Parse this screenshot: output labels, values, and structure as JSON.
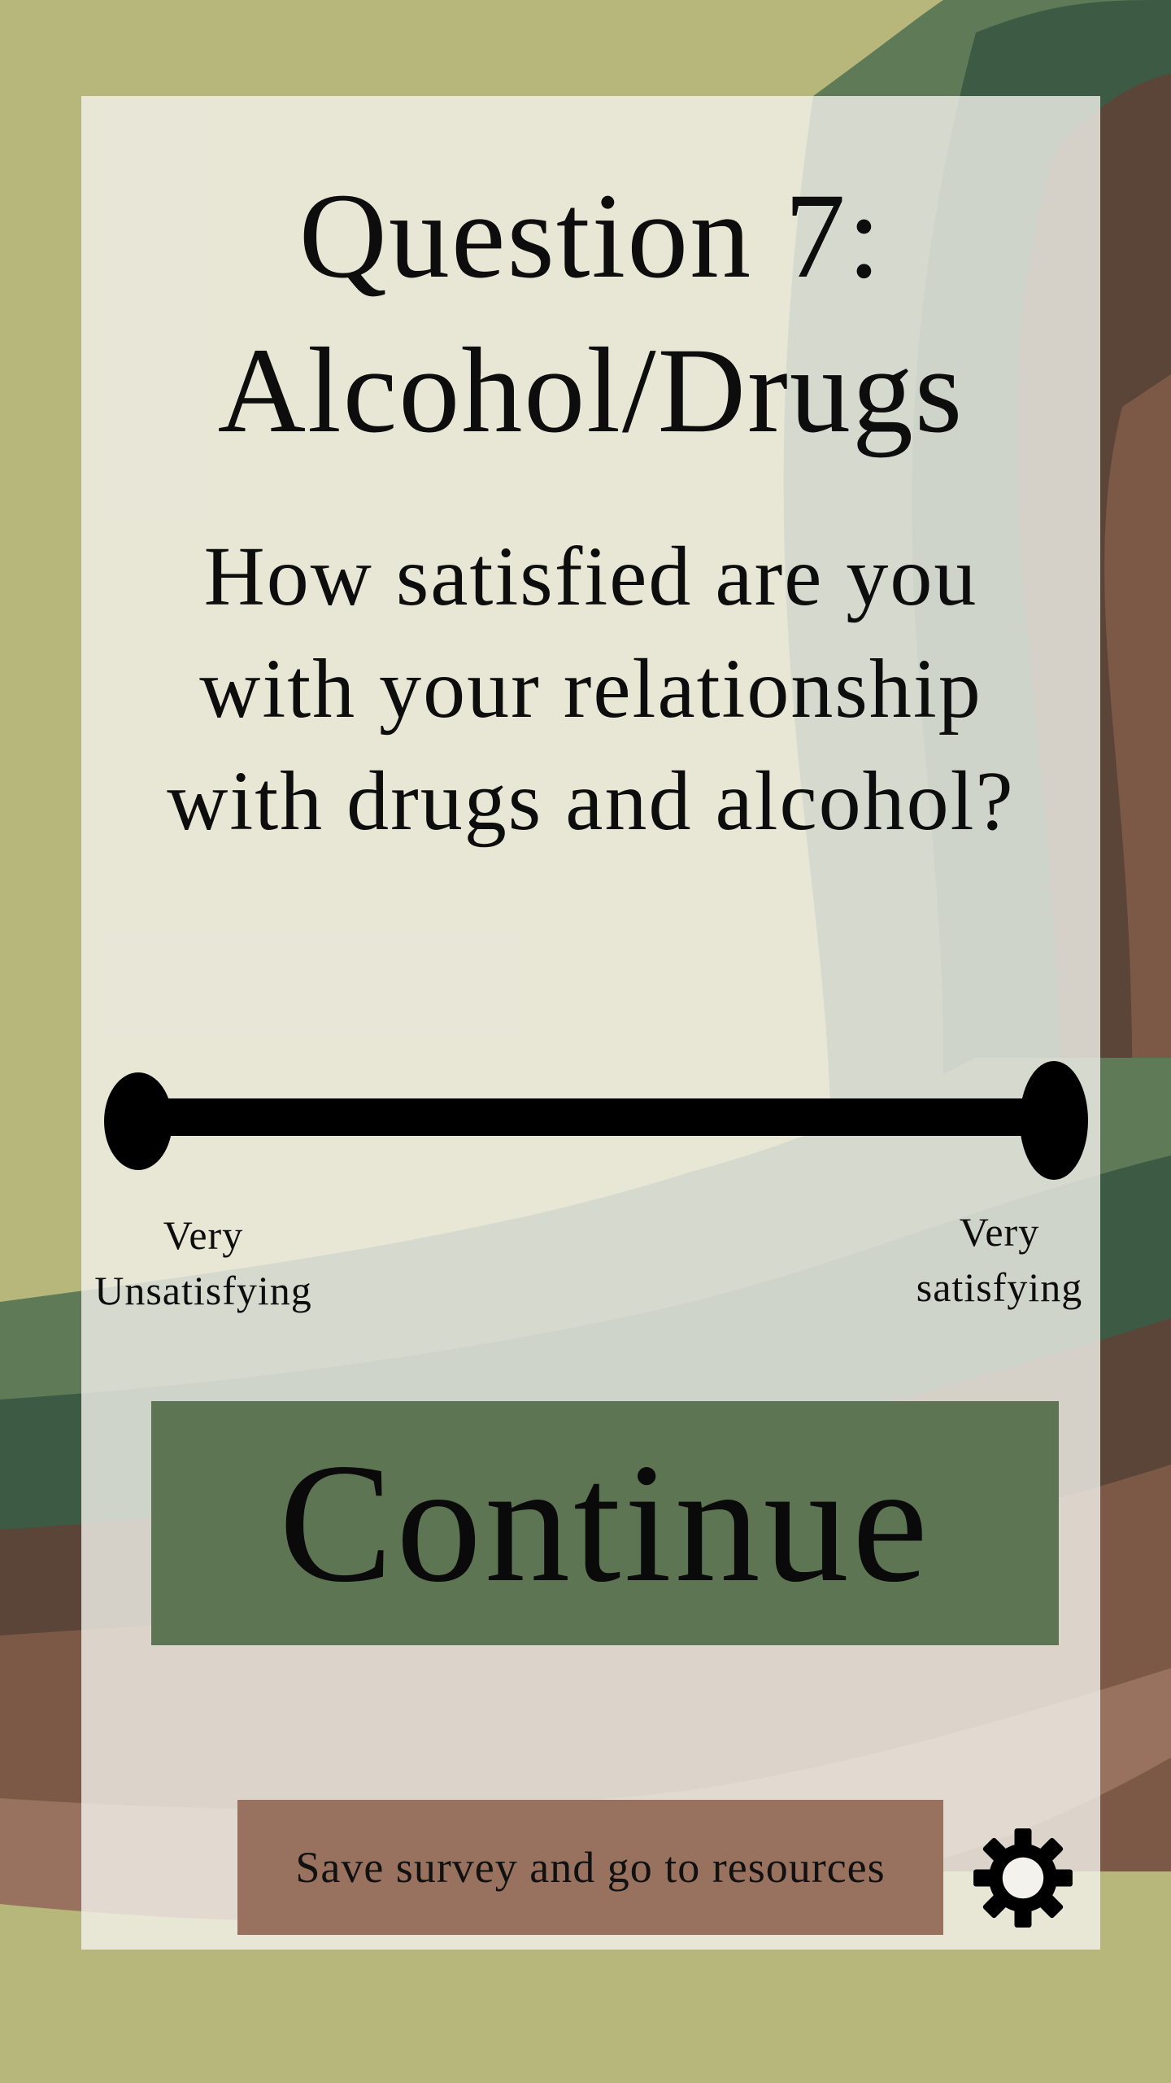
{
  "survey": {
    "title_line1": "Question 7:",
    "title_line2": "Alcohol/Drugs",
    "question": "How satisfied are you with your relationship with drugs and alcohol?"
  },
  "scale": {
    "min_label_line1": "Very",
    "min_label_line2": "Unsatisfying",
    "max_label_line1": "Very",
    "max_label_line2": "satisfying"
  },
  "actions": {
    "continue_label": "Continue",
    "resources_label": "Save survey and go to resources",
    "settings_icon": "gear-icon"
  },
  "colors": {
    "background": "#b7b77c",
    "dark_green": "#3d5a44",
    "mid_green": "#5e7553",
    "dark_brown": "#5a4538",
    "brown": "#7c5846",
    "light_brown": "#99725f",
    "card": "#f4f2ec",
    "blue_grey": "#c5d3d8"
  }
}
